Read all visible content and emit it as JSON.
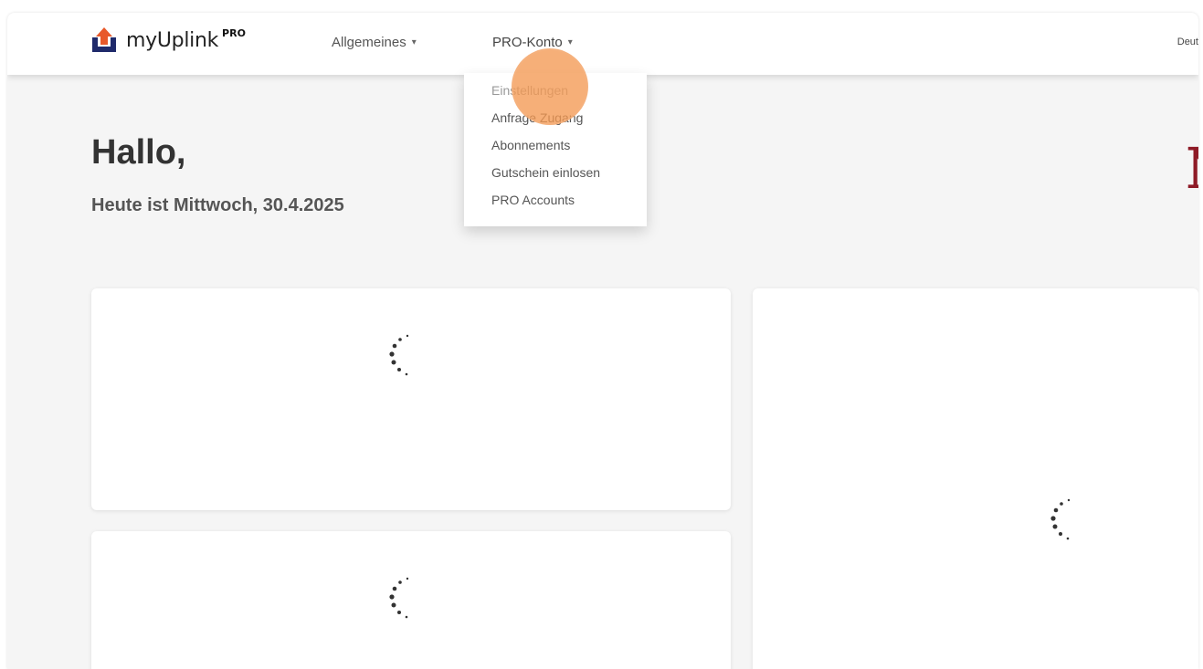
{
  "brand": {
    "name": "myUplink",
    "badge": "PRO",
    "accent_color": "#e8592a",
    "icon": "upload-house-icon"
  },
  "nav": {
    "items": [
      {
        "label": "Allgemeines",
        "icon": "caret-down-icon"
      },
      {
        "label": "PRO-Konto",
        "icon": "caret-down-icon"
      }
    ],
    "language": "Deut"
  },
  "dropdown": {
    "items": [
      {
        "label": "Einstellungen"
      },
      {
        "label": "Anfrage Zugang"
      },
      {
        "label": "Abonnements"
      },
      {
        "label": "Gutschein einlosen"
      },
      {
        "label": "PRO Accounts"
      }
    ]
  },
  "main": {
    "greeting": "Hallo,",
    "date_line": "Heute ist Mittwoch, 30.4.2025",
    "partial_logo_letter": "N",
    "partial_logo_color": "#8e1a26"
  },
  "cards": [
    {
      "state": "loading",
      "icon": "loading-spinner-icon"
    },
    {
      "state": "loading",
      "icon": "loading-spinner-icon"
    },
    {
      "state": "loading",
      "icon": "loading-spinner-icon"
    }
  ],
  "cursor_highlight_color": "#f39952"
}
